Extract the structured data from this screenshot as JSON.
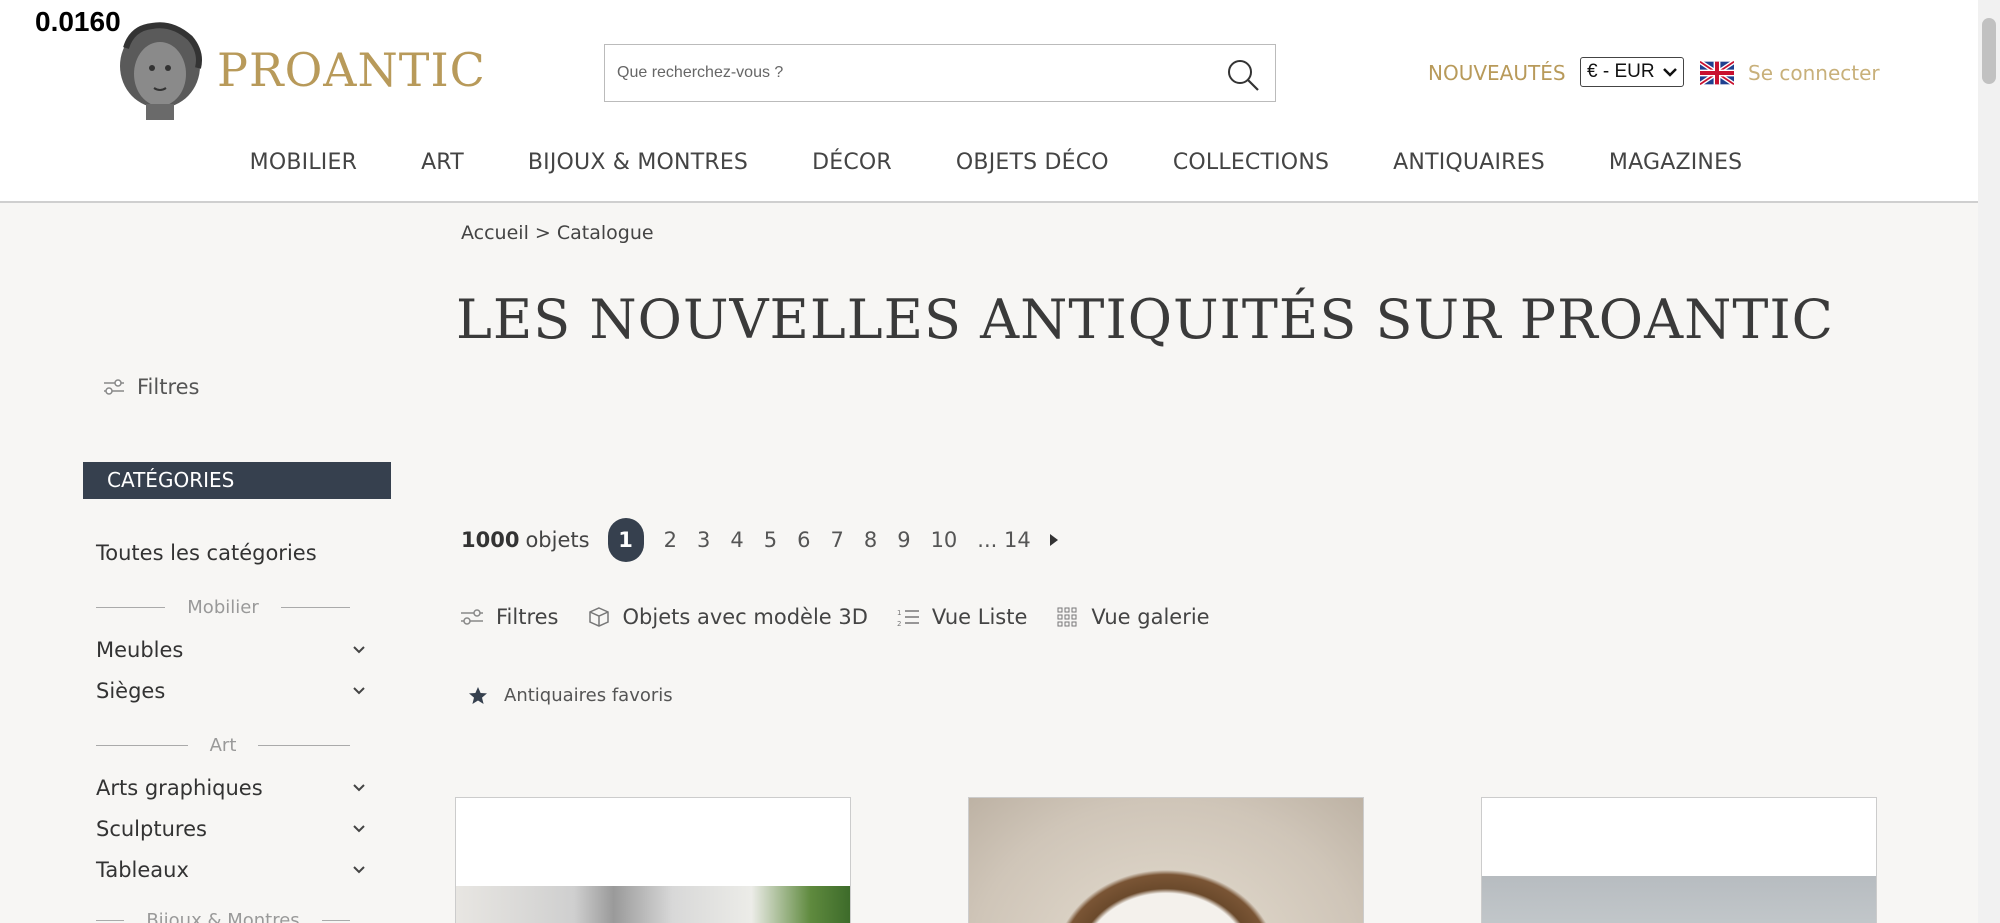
{
  "overlay": {
    "fps": "0.0160"
  },
  "header": {
    "brand": "PROANTIC",
    "search_placeholder": "Que recherchez-vous ?",
    "nouveautes": "NOUVEAUTÉS",
    "currency": "€ - EUR",
    "connect": "Se connecter",
    "accent_color": "#b89a5a"
  },
  "nav": {
    "items": [
      "MOBILIER",
      "ART",
      "BIJOUX & MONTRES",
      "DÉCOR",
      "OBJETS DÉCO",
      "COLLECTIONS",
      "ANTIQUAIRES",
      "MAGAZINES"
    ]
  },
  "breadcrumb": {
    "home": "Accueil",
    "sep": ">",
    "current": "Catalogue"
  },
  "page_title": "LES NOUVELLES ANTIQUITÉS SUR PROANTIC",
  "sidebar": {
    "filters_label": "Filtres",
    "categories_header": "CATÉGORIES",
    "all_categories": "Toutes les catégories",
    "group_mobilier": "Mobilier",
    "item_meubles": "Meubles",
    "item_sieges": "Sièges",
    "group_art": "Art",
    "item_arts_graphiques": "Arts graphiques",
    "item_sculptures": "Sculptures",
    "item_tableaux": "Tableaux",
    "group_bijoux": "Bijoux & Montres"
  },
  "results": {
    "count": "1000",
    "count_label": "objets",
    "current_page": "1",
    "pages": [
      "2",
      "3",
      "4",
      "5",
      "6",
      "7",
      "8",
      "9",
      "10"
    ],
    "last_page": "... 14"
  },
  "toolbar": {
    "filters": "Filtres",
    "objects_3d": "Objets avec modèle 3D",
    "list_view": "Vue Liste",
    "gallery_view": "Vue galerie"
  },
  "favorites": {
    "label": "Antiquaires favoris"
  }
}
